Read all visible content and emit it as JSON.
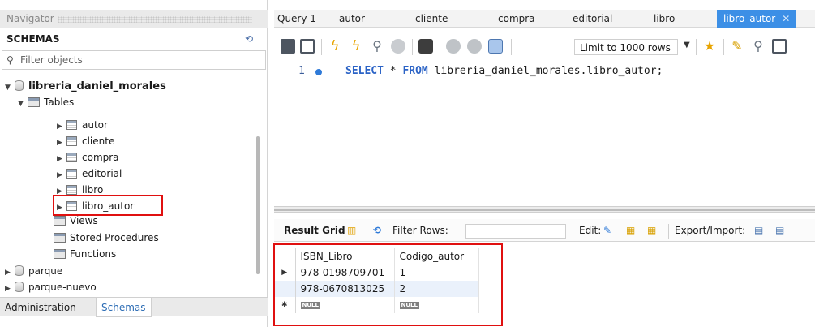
{
  "navigator": {
    "header": "Navigator",
    "schemas_title": "SCHEMAS",
    "filter_placeholder": "Filter objects",
    "active_schema": "libreria_daniel_morales",
    "tables_label": "Tables",
    "tables": [
      "autor",
      "cliente",
      "compra",
      "editorial",
      "libro",
      "libro_autor"
    ],
    "views_label": "Views",
    "stored_procedures_label": "Stored Procedures",
    "functions_label": "Functions",
    "other_schemas": [
      "parque",
      "parque-nuevo"
    ],
    "bottom_tabs": [
      "Administration",
      "Schemas"
    ]
  },
  "query_tabs": [
    "Query 1",
    "autor",
    "cliente",
    "compra",
    "editorial",
    "libro",
    "libro_autor"
  ],
  "active_tab": "libro_autor",
  "toolbar": {
    "limit_label": "Limit to 1000 rows"
  },
  "editor": {
    "line_number": "1",
    "keyword_select": "SELECT",
    "star": "*",
    "keyword_from": "FROM",
    "table_ref": "libreria_daniel_morales.libro_autor;"
  },
  "result": {
    "result_grid_label": "Result Grid",
    "filter_rows_label": "Filter Rows:",
    "edit_label": "Edit:",
    "export_label": "Export/Import:",
    "columns": [
      "ISBN_Libro",
      "Codigo_autor"
    ],
    "rows": [
      [
        "978-0198709701",
        "1"
      ],
      [
        "978-0670813025",
        "2"
      ]
    ],
    "null_label": "NULL"
  },
  "colors": {
    "accent": "#3c8fe6",
    "highlight": "#e01010"
  }
}
